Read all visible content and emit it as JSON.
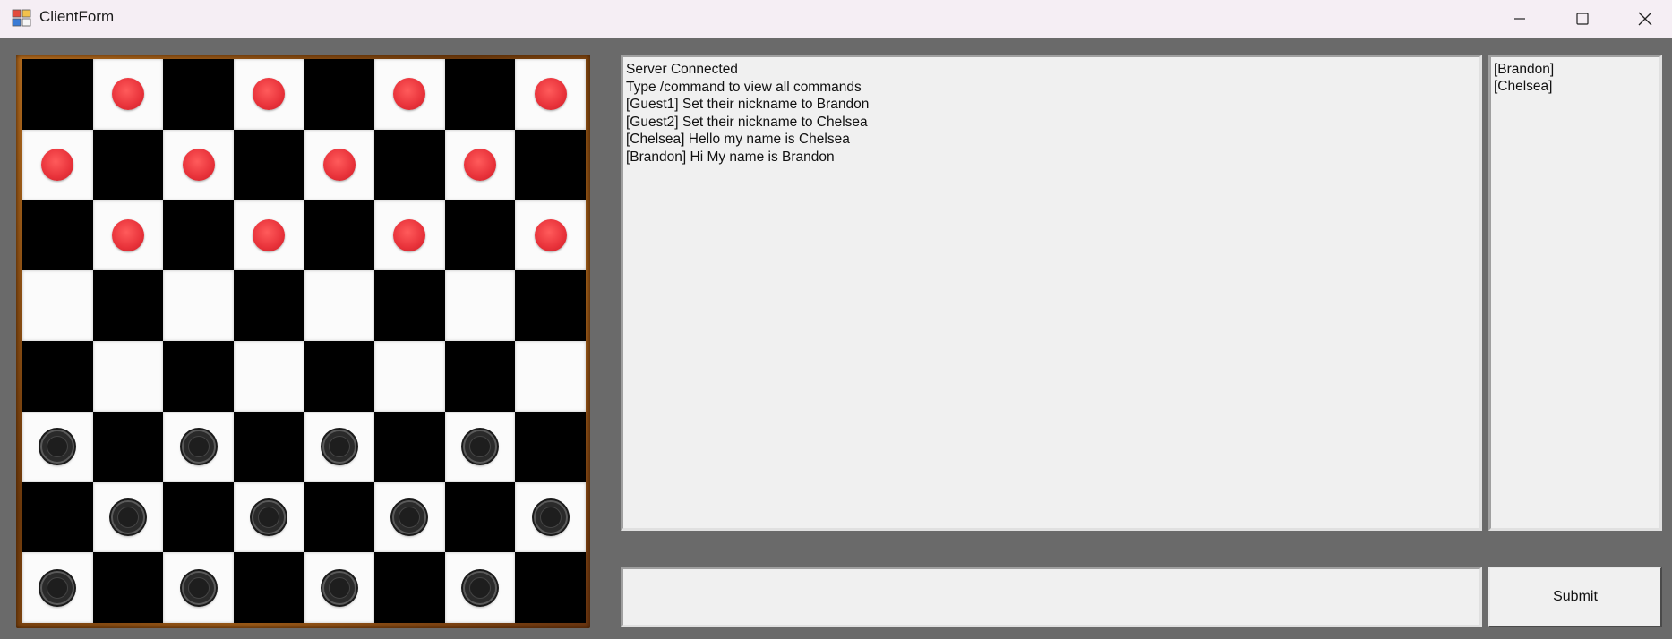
{
  "window": {
    "title": "ClientForm",
    "controls": {
      "minimize_icon": "minimize-icon",
      "maximize_icon": "maximize-icon",
      "close_icon": "close-icon"
    }
  },
  "board": {
    "colors": {
      "dark": "#000000",
      "light": "#fbfbfb",
      "red_piece": "#e8323a",
      "black_piece": "#2a2a2a",
      "frame": "#8a4a14"
    },
    "rows": [
      [
        "",
        "red",
        "",
        "red",
        "",
        "red",
        "",
        "red"
      ],
      [
        "red",
        "",
        "red",
        "",
        "red",
        "",
        "red",
        ""
      ],
      [
        "",
        "red",
        "",
        "red",
        "",
        "red",
        "",
        "red"
      ],
      [
        "",
        "",
        "",
        "",
        "",
        "",
        "",
        ""
      ],
      [
        "",
        "",
        "",
        "",
        "",
        "",
        "",
        ""
      ],
      [
        "black",
        "",
        "black",
        "",
        "black",
        "",
        "black",
        ""
      ],
      [
        "",
        "black",
        "",
        "black",
        "",
        "black",
        "",
        "black"
      ],
      [
        "black",
        "",
        "black",
        "",
        "black",
        "",
        "black",
        ""
      ]
    ]
  },
  "chat": {
    "lines": [
      "Server Connected",
      "Type /command to view all commands",
      "[Guest1] Set their nickname to Brandon",
      "[Guest2] Set their nickname to Chelsea",
      "[Chelsea] Hello my name is Chelsea",
      "[Brandon] Hi My name is Brandon"
    ]
  },
  "users": [
    "[Brandon]",
    "[Chelsea]"
  ],
  "input": {
    "value": "",
    "placeholder": ""
  },
  "submit_label": "Submit"
}
